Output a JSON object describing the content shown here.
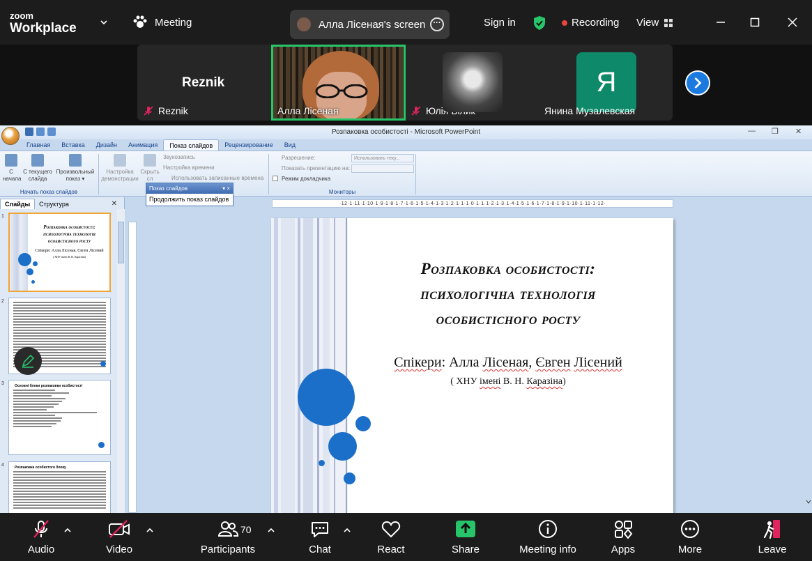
{
  "zoom": {
    "logo_line1": "zoom",
    "logo_line2": "Workplace",
    "meeting_label": "Meeting",
    "screen_share_label": "Алла Лісеная's screen",
    "sign_in": "Sign in",
    "recording_label": "Recording",
    "view_label": "View",
    "colors": {
      "recording": "#e8453c",
      "shield": "#27c46a",
      "active_speaker": "#27c46a",
      "next": "#1a7ae0"
    }
  },
  "gallery": {
    "tiles": [
      {
        "big_label": "Reznik",
        "name": "Reznik",
        "muted": true
      },
      {
        "name": "Алла Лісеная",
        "muted": false,
        "active": true
      },
      {
        "name": "Юлія Білик",
        "muted": true
      },
      {
        "avatar_letter": "Я",
        "name": "Янина Музалевская",
        "muted": false
      }
    ]
  },
  "ppt": {
    "window_title": "Розпаковка особистості - Microsoft PowerPoint",
    "tabs": [
      "Главная",
      "Вставка",
      "Дизайн",
      "Анимация",
      "Показ слайдов",
      "Рецензирование",
      "Вид"
    ],
    "active_tab": "Показ слайдов",
    "ribbon": {
      "from_start_1": "С",
      "from_start_2": "начала",
      "from_current_1": "С текущего",
      "from_current_2": "слайда",
      "custom_1": "Произвольный",
      "custom_2": "показ ▾",
      "group1_label": "Начать показ слайдов",
      "setup_1": "Настройка",
      "setup_2": "демонстрации",
      "hide_1": "Скрыть",
      "hide_2": "сл",
      "record": "Звукозапись",
      "rehearse": "Настройка времени",
      "use_timings": "Использовать записанные времена",
      "resolution_label": "Разрешение:",
      "resolution_value": "Использовать теку...",
      "show_on_label": "Показать презентацию на:",
      "presenter_view": "Режим докладчика",
      "monitors_label": "Мониторы"
    },
    "popup": {
      "title": "Показ слайдов",
      "item": "Продолжить показ слайдов"
    },
    "pane_tabs": [
      "Слайды",
      "Структура"
    ],
    "ruler": "·12·1·11·1·10·1·9·1·8·1·7·1·6·1·5·1·4·1·3·1·2·1·1·1·0·1·1·1·2·1·3·1·4·1·5·1·6·1·7·1·8·1·9·1·10·1·11·1·12·",
    "thumbnails": [
      {
        "num": "1",
        "title_1": "Розпаковка особистості:",
        "title_2": "психологічна технологія",
        "title_3": "особистісного росту",
        "speakers": "Спікери: Алла Лісеная, Євген Лісений",
        "org": "( ХНУ імені В. Н. Каразіна)"
      },
      {
        "num": "2"
      },
      {
        "num": "3",
        "heading": "Основні блоки розпаковки особистості"
      },
      {
        "num": "4",
        "heading": "Розпаковка особистого блоку"
      }
    ],
    "slide": {
      "title_1": "Розпаковка особистості:",
      "title_2": "психологічна технологія",
      "title_3": "особистісного росту",
      "speakers_prefix": "Спікери",
      "speakers_rest": ": Алла ",
      "speaker1_last": "Лісеная",
      "speakers_sep": ", ",
      "speaker2_first": "Євген",
      "speakers_space": " ",
      "speaker2_last": "Лісений",
      "org_1": "( ХНУ ",
      "org_2": "імені",
      "org_3": " В. Н. ",
      "org_4": "Каразіна",
      "org_5": ")",
      "accent_color": "#1b6fc8"
    }
  },
  "toolbar": {
    "audio": "Audio",
    "video": "Video",
    "participants": "Participants",
    "participant_count": "70",
    "chat": "Chat",
    "react": "React",
    "share": "Share",
    "meeting_info": "Meeting info",
    "apps": "Apps",
    "more": "More",
    "leave": "Leave",
    "colors": {
      "share": "#27c46a",
      "leave": "#e0245e"
    }
  }
}
